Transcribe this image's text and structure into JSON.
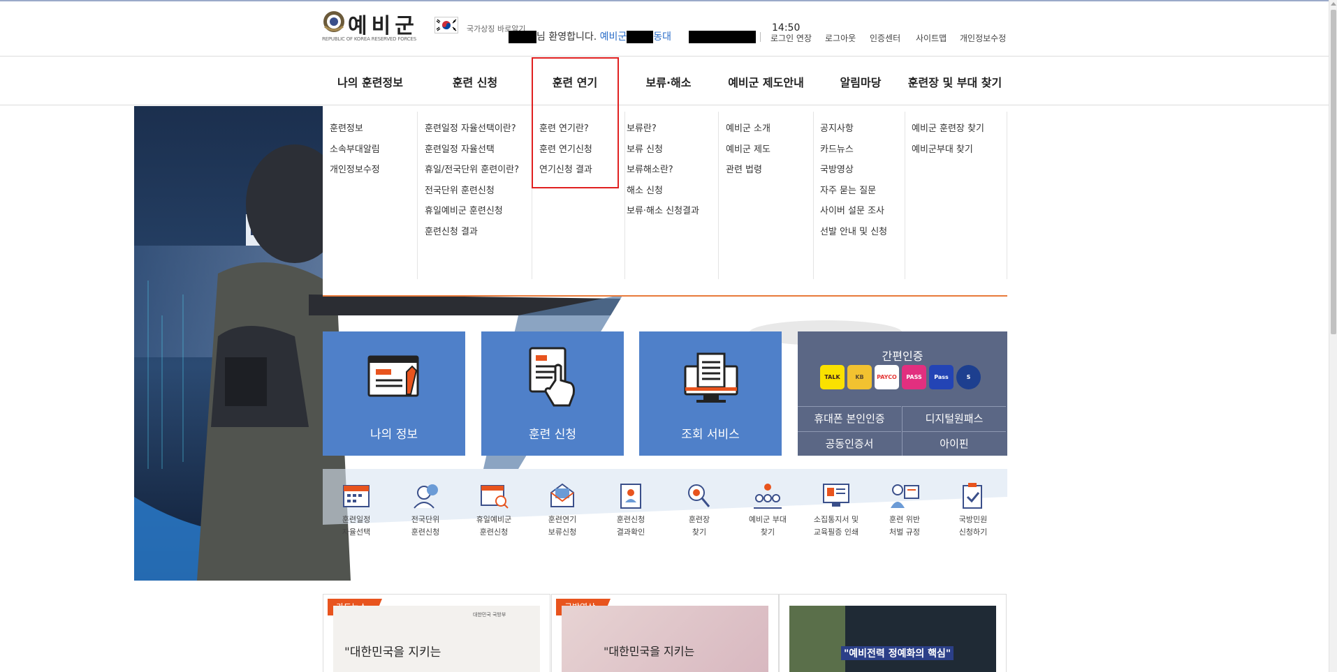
{
  "header": {
    "logo_text": "예비군",
    "logo_sub": "REPUBLIC OF KOREA RESERVED FORCES",
    "flag_link": "국가상징 바로알기",
    "welcome_text": "님 환영합니다.",
    "unit_prefix": "예비군",
    "unit_suffix": "동대",
    "time": "14:50",
    "util_links": [
      "로그인 연장",
      "로그아웃",
      "인증센터",
      "사이트맵",
      "개인정보수정"
    ]
  },
  "gnb": [
    "나의 훈련정보",
    "훈련 신청",
    "훈련 연기",
    "보류·해소",
    "예비군 제도안내",
    "알림마당",
    "훈련장 및 부대 찾기"
  ],
  "mega_menu": [
    [
      "훈련정보",
      "소속부대알림",
      "개인정보수정"
    ],
    [
      "훈련일정 자율선택이란?",
      "훈련일정 자율선택",
      "휴일/전국단위 훈련이란?",
      "전국단위 훈련신청",
      "휴일예비군 훈련신청",
      "훈련신청 결과"
    ],
    [
      "훈련 연기란?",
      "훈련 연기신청",
      "연기신청 결과"
    ],
    [
      "보류란?",
      "보류 신청",
      "보류해소란?",
      "해소 신청",
      "보류·해소 신청결과"
    ],
    [
      "예비군 소개",
      "예비군 제도",
      "관련 법령"
    ],
    [
      "공지사항",
      "카드뉴스",
      "국방영상",
      "자주 묻는 질문",
      "사이버 설문 조사",
      "선발 안내 및 신청"
    ],
    [
      "예비군 훈련장 찾기",
      "예비군부대 찾기"
    ]
  ],
  "tiles": [
    "나의 정보",
    "훈련 신청",
    "조회 서비스"
  ],
  "auth": {
    "title": "간편인증",
    "apps": [
      {
        "label": "TALK",
        "bg": "#fae100",
        "fg": "#3a1d1d"
      },
      {
        "label": "KB",
        "bg": "#f2c230",
        "fg": "#5b4a2c"
      },
      {
        "label": "PAYCO",
        "bg": "#ffffff",
        "fg": "#e43535"
      },
      {
        "label": "PASS",
        "bg": "#e22f7f",
        "fg": "#ffffff"
      },
      {
        "label": "Pass",
        "bg": "#2344b5",
        "fg": "#ffffff"
      },
      {
        "label": "S",
        "bg": "#1d3f8f",
        "fg": "#ffffff"
      }
    ],
    "buttons": [
      "휴대폰 본인인증",
      "디지털원패스",
      "공동인증서",
      "아이핀"
    ]
  },
  "quick_menu": [
    {
      "label": "훈련일정\n자율선택",
      "icon": "calendar-icon"
    },
    {
      "label": "전국단위\n훈련신청",
      "icon": "headset-user-icon"
    },
    {
      "label": "휴일예비군\n훈련신청",
      "icon": "calendar-search-icon"
    },
    {
      "label": "훈련연기\n보류신청",
      "icon": "mail-icon"
    },
    {
      "label": "훈련신청\n결과확인",
      "icon": "document-user-icon"
    },
    {
      "label": "훈련장\n찾기",
      "icon": "location-search-icon"
    },
    {
      "label": "예비군 부대\n찾기",
      "icon": "group-icon"
    },
    {
      "label": "소집통지서 및\n교육필증 인쇄",
      "icon": "monitor-doc-icon"
    },
    {
      "label": "훈련 위반\n처벌 규정",
      "icon": "presentation-icon"
    },
    {
      "label": "국방민원\n신청하기",
      "icon": "clipboard-icon"
    }
  ],
  "cards": [
    "카드뉴스",
    "국방영상"
  ],
  "card_texts": [
    "\"대한민국을 지키는",
    "\"대한민국을 지키는",
    "\"예비전력 정예화의 핵심\"",
    "대한민국 국방부"
  ]
}
